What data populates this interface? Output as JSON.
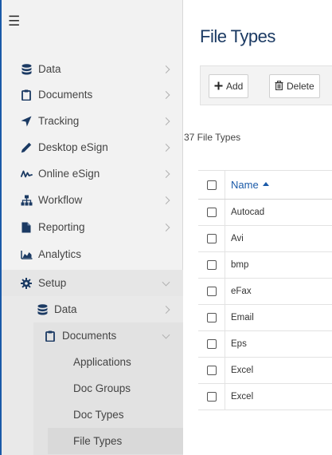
{
  "sidebar": {
    "menu_icon": "hamburger-icon",
    "items": [
      {
        "label": "Data",
        "icon": "database-icon"
      },
      {
        "label": "Documents",
        "icon": "clipboard-icon"
      },
      {
        "label": "Tracking",
        "icon": "location-arrow-icon"
      },
      {
        "label": "Desktop eSign",
        "icon": "pen-icon"
      },
      {
        "label": "Online eSign",
        "icon": "signature-icon"
      },
      {
        "label": "Workflow",
        "icon": "sitemap-icon"
      },
      {
        "label": "Reporting",
        "icon": "file-icon"
      },
      {
        "label": "Analytics",
        "icon": "area-chart-icon"
      },
      {
        "label": "Setup",
        "icon": "gear-icon"
      }
    ],
    "setup_children": [
      {
        "label": "Data",
        "icon": "database-icon"
      },
      {
        "label": "Documents",
        "icon": "clipboard-icon"
      }
    ],
    "documents_children": [
      "Applications",
      "Doc Groups",
      "Doc Types",
      "File Types"
    ]
  },
  "main": {
    "title": "File Types",
    "toolbar": {
      "add_label": "Add",
      "delete_label": "Delete"
    },
    "count_text": "37 File Types",
    "table": {
      "header_name": "Name",
      "sort": "ascending",
      "rows": [
        "Autocad",
        "Avi",
        "bmp",
        "eFax",
        "Email",
        "Eps",
        "Excel",
        "Excel"
      ]
    }
  },
  "colors": {
    "accent": "#1a5aa8",
    "icon_dark": "#1b3a63",
    "title": "#1b3a63",
    "sidebar_bg": "#f2f2f2"
  }
}
